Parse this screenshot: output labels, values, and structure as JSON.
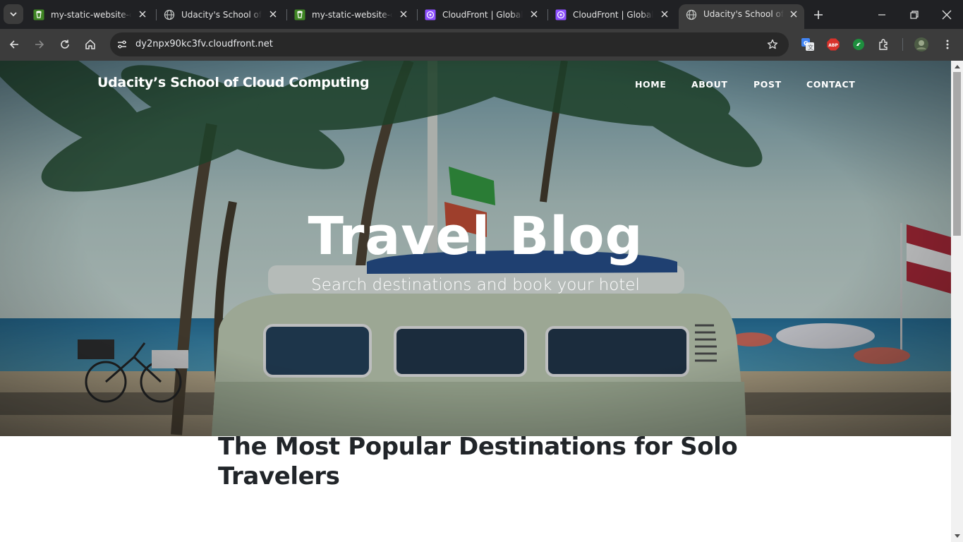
{
  "browser": {
    "tabs": [
      {
        "title": "my-static-website-co",
        "favicon": "s3-bucket-icon",
        "active": false
      },
      {
        "title": "Udacity's School of Cl",
        "favicon": "globe-icon",
        "active": false
      },
      {
        "title": "my-static-website-co",
        "favicon": "s3-bucket-icon",
        "active": false
      },
      {
        "title": "CloudFront | Global",
        "favicon": "cloudfront-icon",
        "active": false
      },
      {
        "title": "CloudFront | Global",
        "favicon": "cloudfront-icon",
        "active": false
      },
      {
        "title": "Udacity's School of Cl",
        "favicon": "globe-icon",
        "active": true
      }
    ],
    "address_bar": {
      "url": "dy2npx90kc3fv.cloudfront.net"
    },
    "extensions": {
      "adblock_label": "ABP"
    },
    "colors": {
      "tabstrip": "#202124",
      "toolbar": "#3c3c3c",
      "omnibox": "#282828"
    }
  },
  "page": {
    "brand": "Udacity’s School of Cloud Computing",
    "nav": [
      {
        "label": "HOME"
      },
      {
        "label": "ABOUT"
      },
      {
        "label": "POST"
      },
      {
        "label": "CONTACT"
      }
    ],
    "hero": {
      "title": "Travel Blog",
      "subtitle": "Search destinations and book your hotel"
    },
    "post": {
      "title": "The Most Popular Destinations for Solo Travelers"
    }
  }
}
